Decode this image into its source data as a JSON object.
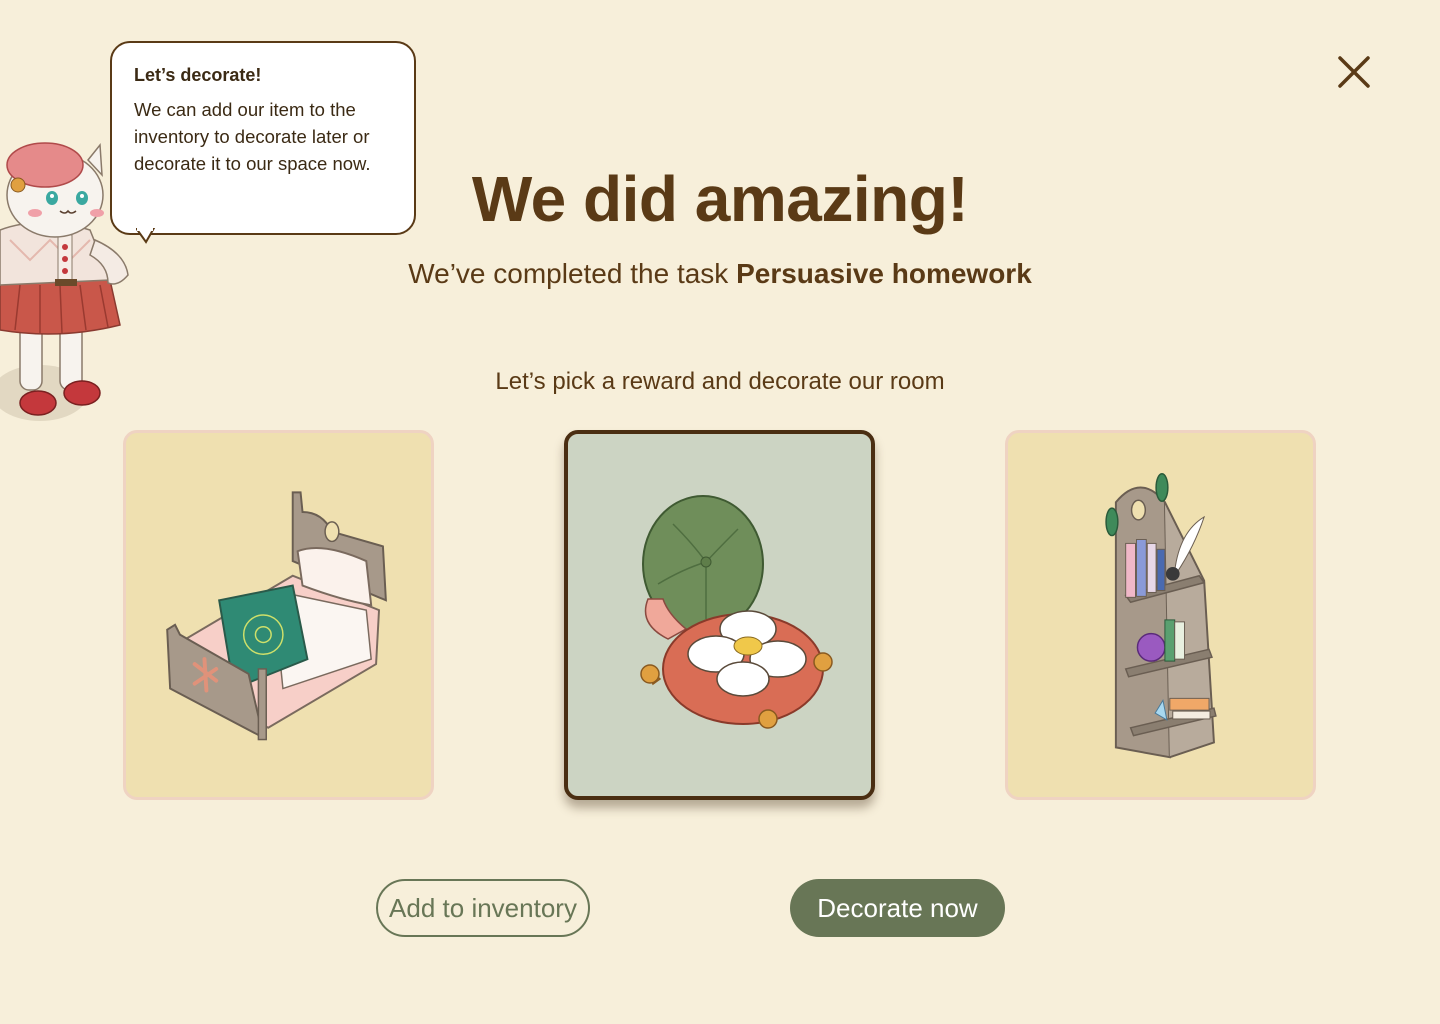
{
  "colors": {
    "background": "#f7efda",
    "primary_text": "#5a3a16",
    "accent_green": "#687656",
    "card_yellow": "#efe0b0",
    "card_selected": "#ccd4c3"
  },
  "tooltip": {
    "title": "Let’s decorate!",
    "body": "We can add our item to the inventory to decorate later or decorate it to our space now."
  },
  "header": {
    "headline": "We did amazing!",
    "subtitle_prefix": "We’ve completed the task ",
    "task_name": "Persuasive homework",
    "prompt": "Let’s pick a reward and decorate our room"
  },
  "rewards": [
    {
      "icon": "bed-icon",
      "selected": false
    },
    {
      "icon": "floor-cushion-icon",
      "selected": true
    },
    {
      "icon": "bookshelf-icon",
      "selected": false
    }
  ],
  "actions": {
    "add_to_inventory": "Add to inventory",
    "decorate_now": "Decorate now"
  },
  "close_icon": "close-icon",
  "mascot_icon": "cat-mascot-icon"
}
